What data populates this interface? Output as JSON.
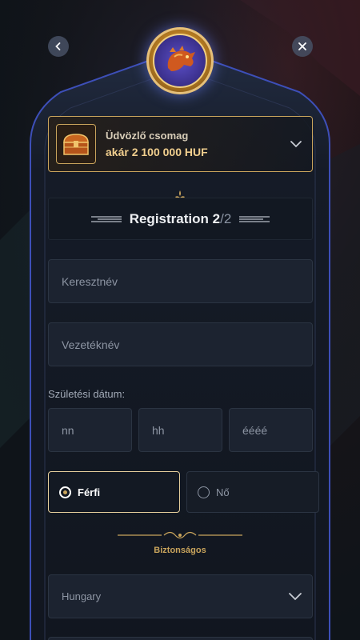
{
  "bonus": {
    "title": "Üdvözlő csomag",
    "amount": "akár 2 100 000 HUF"
  },
  "registration": {
    "label": "Registration",
    "step": "2",
    "separator": "/",
    "total": "2"
  },
  "fields": {
    "first_name_placeholder": "Keresztnév",
    "last_name_placeholder": "Vezetéknév",
    "dob_label": "Születési dátum:",
    "day_placeholder": "nn",
    "month_placeholder": "hh",
    "year_placeholder": "éééé"
  },
  "gender": {
    "options": [
      {
        "label": "Férfi",
        "selected": true
      },
      {
        "label": "Nő",
        "selected": false
      }
    ]
  },
  "security_label": "Biztonságos",
  "country": {
    "selected": "Hungary"
  },
  "icons": {
    "back": "chevron-left-icon",
    "close": "close-icon",
    "medal": "dragon-medal-icon",
    "chest": "treasure-chest-icon",
    "dropdown": "chevron-down-icon"
  },
  "colors": {
    "accent_gold": "#c9a45c",
    "panel_border": "#3d4fb8",
    "field_bg": "#1c2330"
  }
}
